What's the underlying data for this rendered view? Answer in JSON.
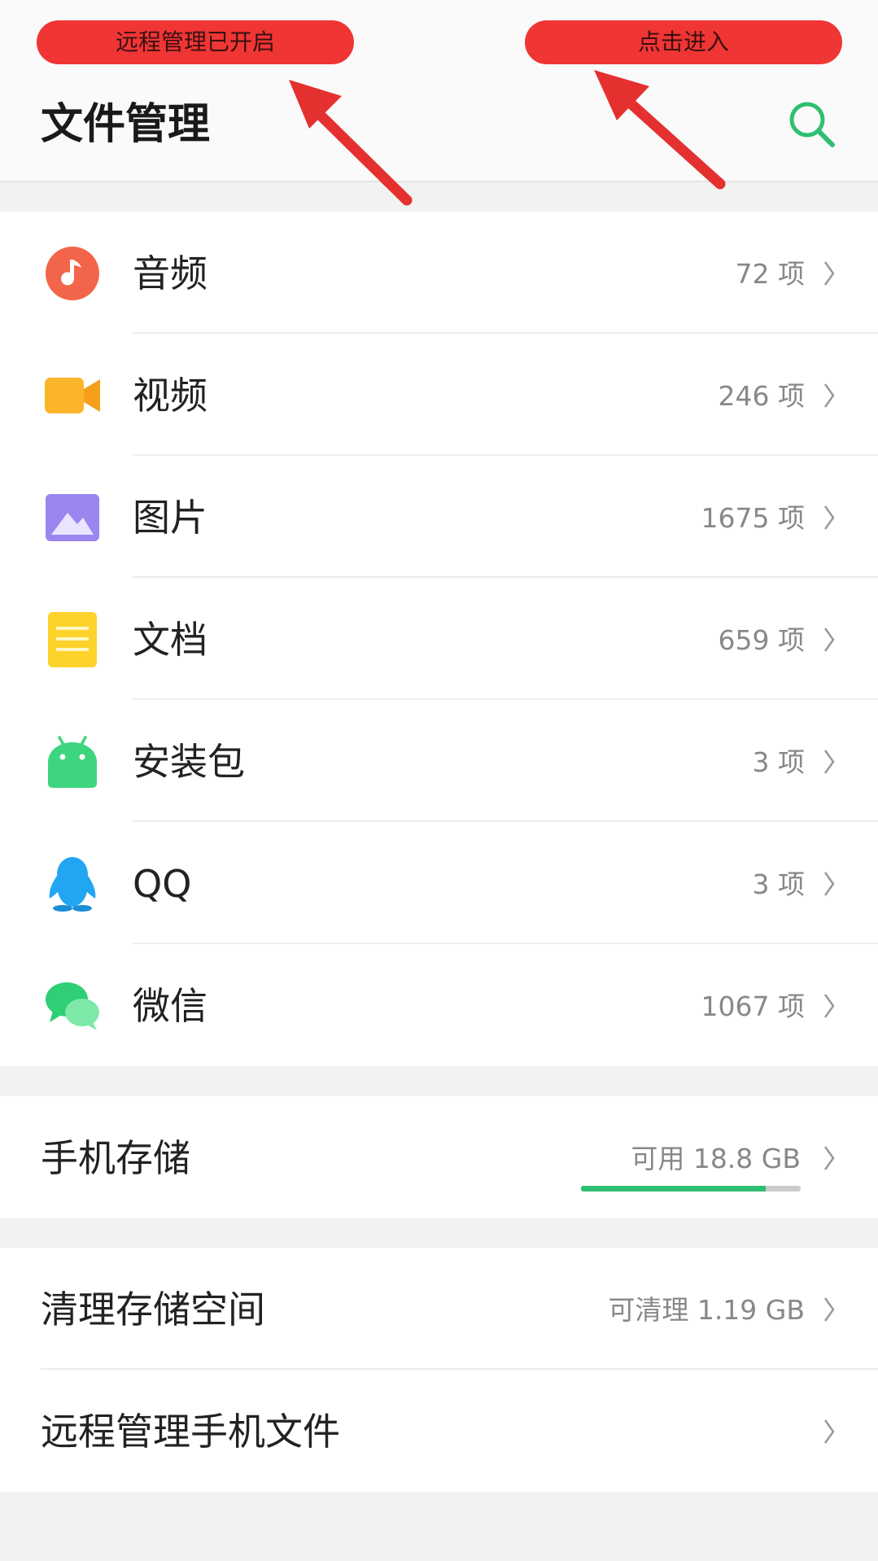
{
  "annotations": {
    "left_pill": "远程管理已开启",
    "right_pill": "点击进入",
    "color": "#f03535"
  },
  "header": {
    "title": "文件管理",
    "search_icon": "search-icon",
    "accent": "#2fbf71"
  },
  "categories": [
    {
      "label": "音频",
      "count": "72 项",
      "icon": "music-note-icon"
    },
    {
      "label": "视频",
      "count": "246 项",
      "icon": "video-camera-icon"
    },
    {
      "label": "图片",
      "count": "1675 项",
      "icon": "picture-icon"
    },
    {
      "label": "文档",
      "count": "659 项",
      "icon": "document-icon"
    },
    {
      "label": "安装包",
      "count": "3 项",
      "icon": "android-icon"
    },
    {
      "label": "QQ",
      "count": "3 项",
      "icon": "qq-penguin-icon"
    },
    {
      "label": "微信",
      "count": "1067 项",
      "icon": "wechat-icon"
    }
  ],
  "storage": {
    "label": "手机存储",
    "available": "可用 18.8 GB",
    "used_fraction": 0.84
  },
  "tools": [
    {
      "label": "清理存储空间",
      "value": "可清理 1.19 GB"
    },
    {
      "label": "远程管理手机文件",
      "value": ""
    }
  ]
}
